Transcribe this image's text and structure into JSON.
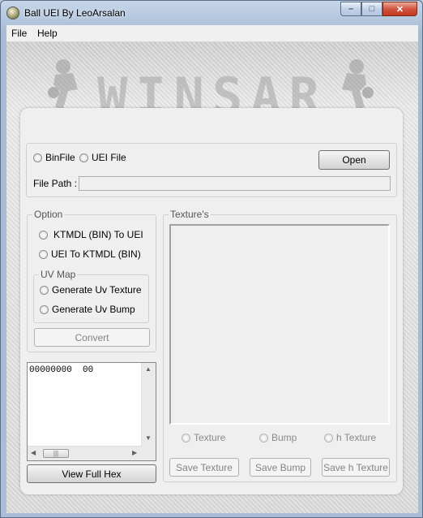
{
  "window": {
    "title": "Ball UEI By LeoArsalan",
    "caption": {
      "minimize": "–",
      "maximize": "□",
      "close": "✕"
    }
  },
  "menu": [
    "File",
    "Help"
  ],
  "banner": {
    "text": "WINSAR"
  },
  "file_select": {
    "options": [
      "BinFile",
      "UEI File"
    ],
    "open_label": "Open",
    "path_label": "File Path :",
    "path_value": ""
  },
  "option_group": {
    "title": "Option",
    "options": [
      "KTMDL (BIN) To UEI",
      "UEI To KTMDL (BIN)"
    ],
    "uv_title": "UV Map",
    "uv_options": [
      "Generate Uv Texture",
      "Generate Uv Bump"
    ],
    "convert_label": "Convert"
  },
  "hex": {
    "content": "00000000  00",
    "view_full_label": "View Full Hex",
    "scroll_thumb": "|||"
  },
  "textures": {
    "title": "Texture's",
    "radios": [
      "Texture",
      "Bump",
      "h Texture"
    ],
    "buttons": [
      "Save Texture",
      "Save Bump",
      "Save h Texture"
    ]
  },
  "icons": {
    "app": "ball-icon",
    "scroll_up": "▲",
    "scroll_down": "▼",
    "scroll_left": "◀",
    "scroll_right": "▶"
  }
}
